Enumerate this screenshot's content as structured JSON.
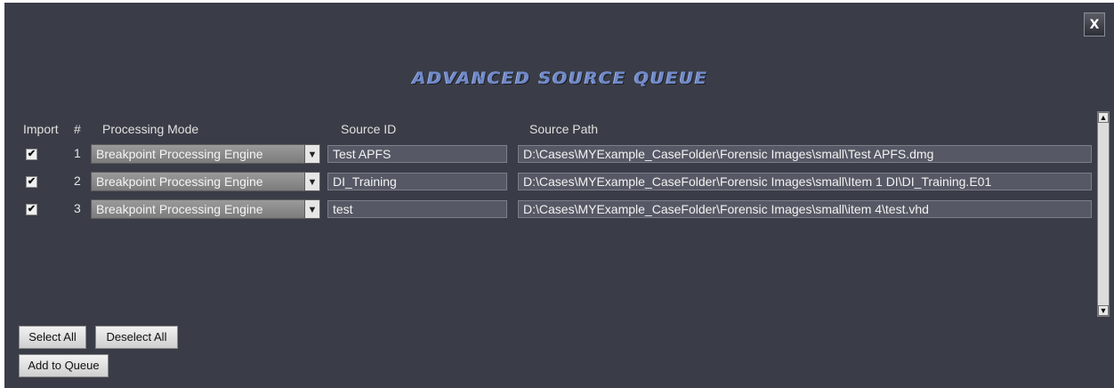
{
  "window": {
    "title": "ADVANCED SOURCE QUEUE",
    "close_label": "X"
  },
  "table": {
    "headers": {
      "import": "Import",
      "number": "#",
      "processing_mode": "Processing Mode",
      "source_id": "Source ID",
      "source_path": "Source Path"
    },
    "rows": [
      {
        "checked": true,
        "number": "1",
        "mode": "Breakpoint Processing Engine",
        "source_id": "Test APFS",
        "source_path": "D:\\Cases\\MYExample_CaseFolder\\Forensic Images\\small\\Test APFS.dmg"
      },
      {
        "checked": true,
        "number": "2",
        "mode": "Breakpoint Processing Engine",
        "source_id": "DI_Training",
        "source_path": "D:\\Cases\\MYExample_CaseFolder\\Forensic Images\\small\\Item 1 DI\\DI_Training.E01"
      },
      {
        "checked": true,
        "number": "3",
        "mode": "Breakpoint Processing Engine",
        "source_id": "test",
        "source_path": "D:\\Cases\\MYExample_CaseFolder\\Forensic Images\\small\\item 4\\test.vhd"
      }
    ]
  },
  "buttons": {
    "select_all": "Select All",
    "deselect_all": "Deselect All",
    "add_to_queue": "Add to Queue"
  },
  "icons": {
    "checkbox_checked": "check-mark-icon",
    "dropdown": "chevron-down-icon",
    "scroll_up": "arrow-up-icon",
    "scroll_down": "arrow-down-icon"
  },
  "colors": {
    "window_bg": "#3a3d47",
    "title": "#6f88c8",
    "field_bg": "#565965"
  }
}
